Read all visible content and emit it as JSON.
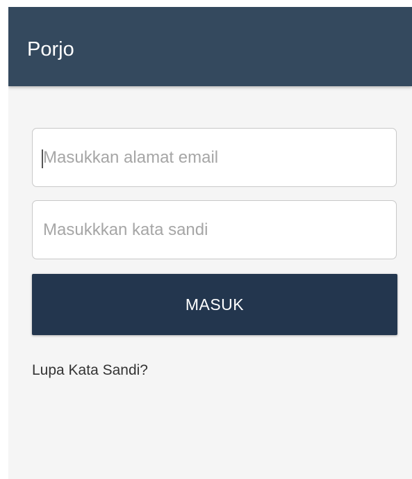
{
  "app": {
    "title": "Porjo",
    "colors": {
      "appbar": "#34495e",
      "button": "#23364e",
      "background": "#f5f5f5"
    }
  },
  "login_form": {
    "email_placeholder": "Masukkan alamat email",
    "email_value": "",
    "password_placeholder": "Masukkkan kata sandi",
    "password_value": "",
    "submit_label": "MASUK",
    "forgot_password_label": "Lupa Kata Sandi?"
  }
}
